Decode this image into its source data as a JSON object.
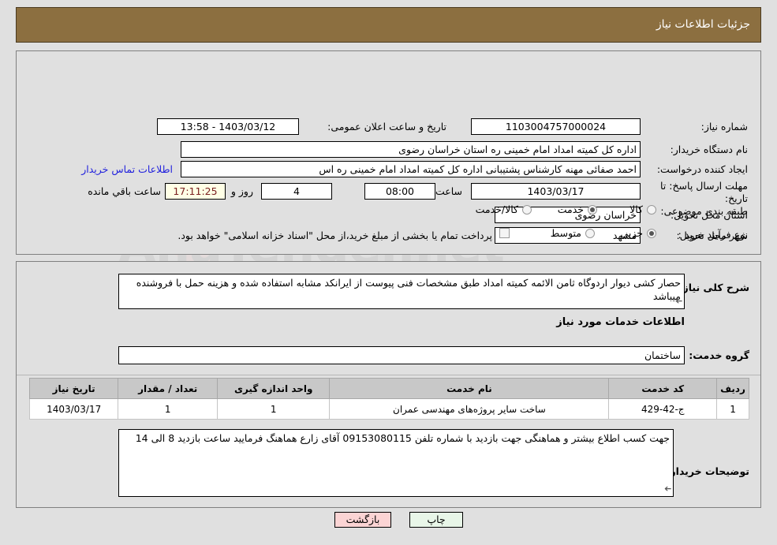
{
  "header": {
    "title": "جزئیات اطلاعات نیاز",
    "bar_color": "#8c6f40"
  },
  "need_info": {
    "need_number_label": "شماره نیاز:",
    "need_number_value": "1103004757000024",
    "announce_label": "تاریخ و ساعت اعلان عمومی:",
    "announce_value": "1403/03/12 - 13:58",
    "buyer_org_label": "نام دستگاه خریدار:",
    "buyer_org_value": "اداره کل کمیته امداد امام خمینی  ره  استان خراسان رضوی",
    "requester_label": "ایجاد کننده درخواست:",
    "requester_value": "احمد صفائی مهنه کارشناس پشتیبانی اداره کل کمیته امداد امام خمینی  ره  اس",
    "contact_link": "اطلاعات تماس خریدار",
    "deadline_label": "مهلت ارسال پاسخ: تا تاریخ:",
    "deadline_date": "1403/03/17",
    "hour_label": "ساعت",
    "deadline_time": "08:00",
    "days_value": "4",
    "days_label": "روز و",
    "countdown_value": "17:11:25",
    "countdown_label": "ساعت باقي مانده",
    "province_label": "استان محل تحویل:",
    "province_value": "خراسان رضوی",
    "city_label": "شهر محل تحویل:",
    "city_value": "مشهد",
    "category_label": "طبقه بندی موضوعی:",
    "category_options": [
      {
        "label": "کالا",
        "selected": false
      },
      {
        "label": "خدمت",
        "selected": true
      },
      {
        "label": "کالا/خدمت",
        "selected": false
      }
    ],
    "process_label": "نوع فرآیند خرید :",
    "process_options": [
      {
        "label": "جزیی",
        "selected": true
      },
      {
        "label": "متوسط",
        "selected": false
      }
    ],
    "treasury_checkbox_label": "پرداخت تمام یا بخشی از مبلغ خرید،از محل \"اسناد خزانه اسلامی\" خواهد بود.",
    "treasury_checked": false
  },
  "need_detail": {
    "summary_label": "شرح کلی نیاز:",
    "summary_value": "حصار کشی دیوار اردوگاه ثامن الائمه کمیته امداد طبق مشخصات فنی پیوست از ایرانکد مشابه استفاده شده و هزینه حمل با فروشنده میباشد",
    "section_title": "اطلاعات خدمات مورد نیاز",
    "service_group_label": "گروه خدمت:",
    "service_group_value": "ساختمان",
    "table": {
      "columns": [
        "ردیف",
        "کد خدمت",
        "نام خدمت",
        "واحد اندازه گیری",
        "تعداد / مقدار",
        "تاریخ نیاز"
      ],
      "rows": [
        [
          "1",
          "ج-42-429",
          "ساخت سایر پروژه‌های مهندسی عمران",
          "1",
          "1",
          "1403/03/17"
        ]
      ]
    },
    "buyer_notes_label": "توضیحات خریدار:",
    "buyer_notes_value": "جهت کسب اطلاع بیشتر و هماهنگی جهت بازدید با شماره تلفن 09153080115 آقای زارع هماهنگ فرمایید ساعت بازدید 8 الی 14"
  },
  "footer": {
    "print_label": "چاپ",
    "back_label": "بازگشت"
  },
  "watermark": {
    "text": "AnaTender.net"
  }
}
